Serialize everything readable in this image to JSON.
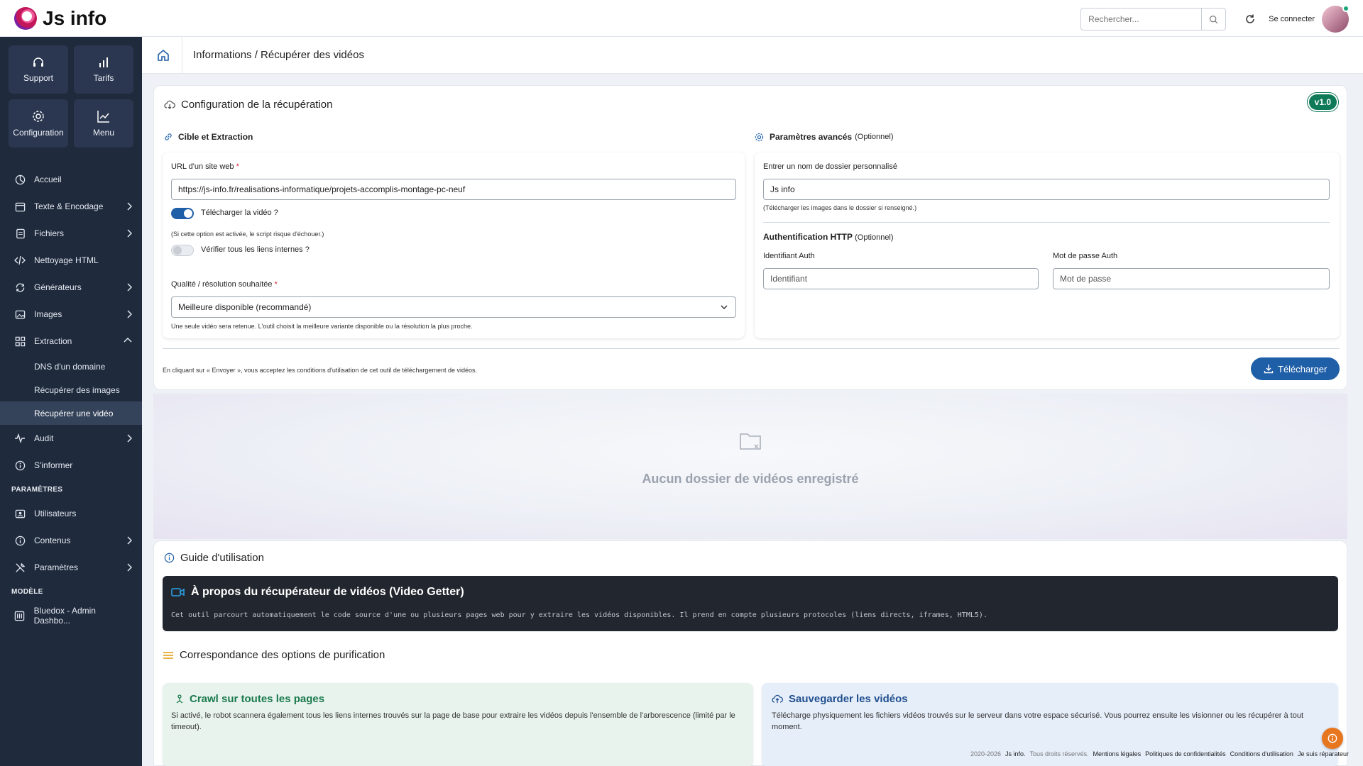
{
  "app": {
    "name": "Js info"
  },
  "header": {
    "search_placeholder": "Rechercher...",
    "login_label": "Se connecter"
  },
  "sidebar": {
    "quick": [
      {
        "label": "Support",
        "icon": "headset-icon"
      },
      {
        "label": "Tarifs",
        "icon": "bar-chart-icon"
      },
      {
        "label": "Configuration",
        "icon": "gear-icon"
      },
      {
        "label": "Menu",
        "icon": "trend-chart-icon"
      }
    ],
    "items": [
      {
        "label": "Accueil"
      },
      {
        "label": "Texte & Encodage"
      },
      {
        "label": "Fichiers"
      },
      {
        "label": "Nettoyage HTML"
      },
      {
        "label": "Générateurs"
      },
      {
        "label": "Images"
      },
      {
        "label": "Extraction"
      },
      {
        "label": "Audit"
      },
      {
        "label": "S'informer"
      }
    ],
    "extraction_sub": [
      {
        "label": "DNS d'un domaine"
      },
      {
        "label": "Récupérer des images"
      },
      {
        "label": "Récupérer une vidéo"
      }
    ],
    "section_params": "PARAMÈTRES",
    "params_items": [
      {
        "label": "Utilisateurs"
      },
      {
        "label": "Contenus"
      },
      {
        "label": "Paramètres"
      }
    ],
    "section_model": "MODÈLE",
    "model_items": [
      {
        "label": "Bluedox - Admin Dashbo..."
      }
    ]
  },
  "breadcrumb": {
    "text": "Informations / Récupérer des vidéos"
  },
  "config": {
    "title": "Configuration de la récupération",
    "version": "v1.0",
    "left": {
      "heading": "Cible et Extraction",
      "url_label": "URL d'un site web",
      "req": "*",
      "url_value": "https://js-info.fr/realisations-informatique/projets-accomplis-montage-pc-neuf",
      "toggle1_label": "Télécharger la vidéo ?",
      "toggle1_on": true,
      "toggle1_note": "(Si cette option est activée, le script risque d'échouer.)",
      "toggle2_label": "Vérifier tous les liens internes ?",
      "toggle2_on": false,
      "quality_label": "Qualité / résolution souhaitée",
      "quality_value": "Meilleure disponible (recommandé)",
      "quality_note": "Une seule vidéo sera retenue. L'outil choisit la meilleure variante disponible ou la résolution la plus proche."
    },
    "right": {
      "heading": "Paramètres avancés",
      "heading_opt": "(Optionnel)",
      "folder_label": "Entrer un nom de dossier personnalisé",
      "folder_value": "Js info",
      "folder_note": "(Télécharger les images dans le dossier si renseigné.)",
      "auth_heading": "Authentification HTTP",
      "auth_opt": "(Optionnel)",
      "auth_id_label": "Identifiant Auth",
      "auth_id_placeholder": "Identifiant",
      "auth_pw_label": "Mot de passe Auth",
      "auth_pw_placeholder": "Mot de passe"
    },
    "terms": "En cliquant sur « Envoyer », vous acceptez les conditions d'utilisation de cet outil de téléchargement de vidéos.",
    "download_label": "Télécharger"
  },
  "empty_state": {
    "text": "Aucun dossier de vidéos enregistré"
  },
  "guide": {
    "title": "Guide d'utilisation",
    "about_title": "À propos du récupérateur de vidéos (Video Getter)",
    "about_text": "Cet outil parcourt automatiquement le code source d'une ou plusieurs pages web pour y extraire les vidéos disponibles. Il prend en compte plusieurs protocoles (liens directs, iframes, HTML5).",
    "purif_title": "Correspondance des options de purification",
    "crawl_title": "Crawl sur toutes les pages",
    "crawl_text": "Si activé, le robot scannera également tous les liens internes trouvés sur la page de base pour extraire les vidéos depuis l'ensemble de l'arborescence (limité par le timeout).",
    "save_title": "Sauvegarder les vidéos",
    "save_text": "Télécharge physiquement les fichiers vidéos trouvés sur le serveur dans votre espace sécurisé. Vous pourrez ensuite les visionner ou les récupérer à tout moment."
  },
  "footer": {
    "copyright": "2020-2026",
    "brand": "Js info.",
    "rights": "Tous droits réservés.",
    "links": [
      "Mentions légales",
      "Politiques de confidentialités",
      "Conditions d'utilisation",
      "Je suis réparateur"
    ]
  },
  "colors": {
    "primary": "#1f5fa8",
    "sidebar": "#1f2a3c",
    "version": "#0f7a58",
    "crawl": "#1a7a4c",
    "save": "#1f4f8f"
  }
}
